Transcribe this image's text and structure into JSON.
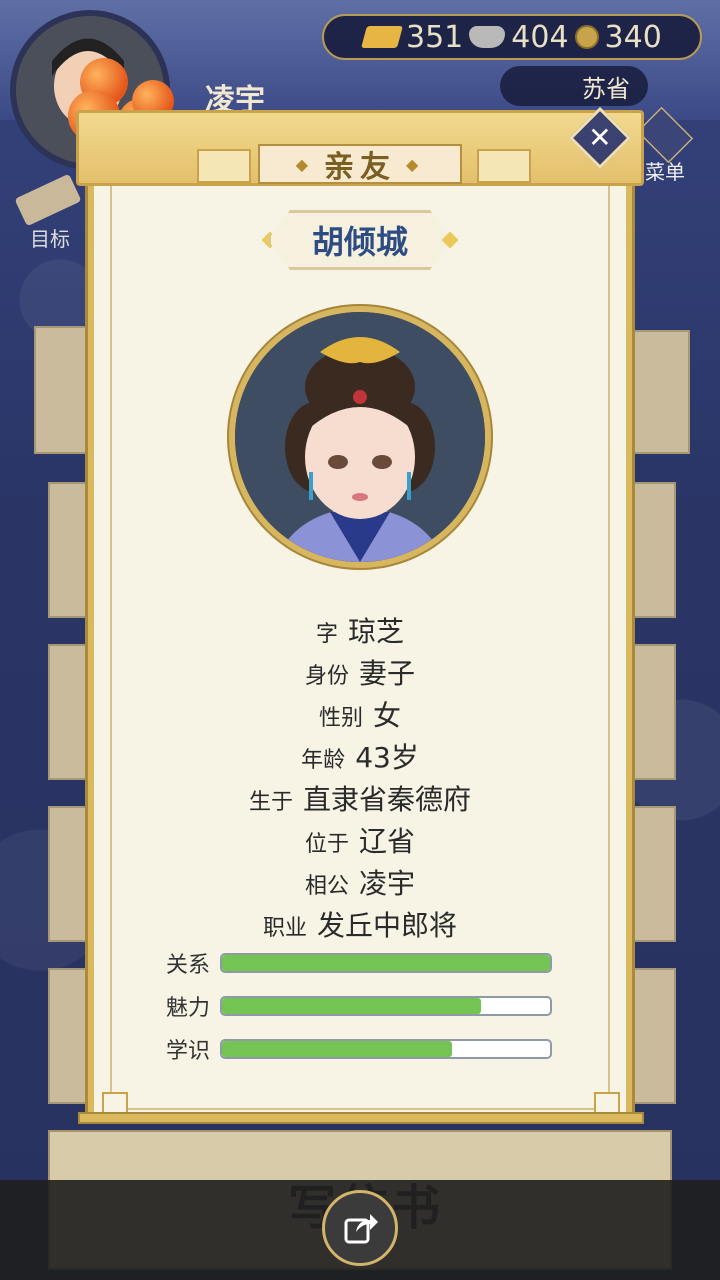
{
  "hud": {
    "player_name": "凌宇",
    "currency": {
      "gold": "351",
      "silver": "404",
      "coins": "340"
    },
    "location": "苏省",
    "menu_label": "菜单",
    "goal_label": "目标",
    "write_letter_label": "写信书"
  },
  "dialog": {
    "title": "亲友",
    "name": "胡倾城",
    "details": [
      {
        "label": "字",
        "value": "琼芝"
      },
      {
        "label": "身份",
        "value": "妻子"
      },
      {
        "label": "性别",
        "value": "女"
      },
      {
        "label": "年龄",
        "value": "43岁"
      },
      {
        "label": "生于",
        "value": "直隶省秦德府"
      },
      {
        "label": "位于",
        "value": "辽省"
      },
      {
        "label": "相公",
        "value": "凌宇"
      },
      {
        "label": "职业",
        "value": "发丘中郎将"
      }
    ],
    "stats": [
      {
        "label": "关系",
        "level": 1.0
      },
      {
        "label": "魅力",
        "level": 0.79
      },
      {
        "label": "学识",
        "level": 0.7
      }
    ]
  },
  "icons": {
    "close": "close-icon",
    "share": "share-icon",
    "gold": "gold-ingot-icon",
    "silver": "silver-ingot-icon",
    "coin": "copper-coin-icon"
  }
}
